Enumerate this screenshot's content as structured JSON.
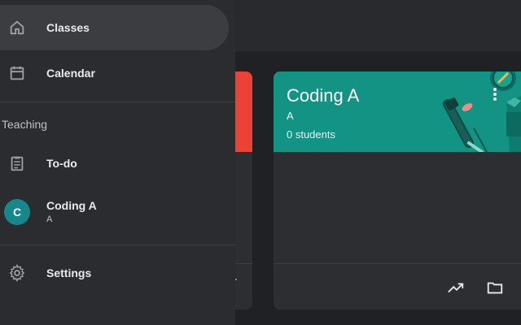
{
  "drawer": {
    "items": {
      "classes": {
        "label": "Classes",
        "icon": "home-icon",
        "active": true
      },
      "calendar": {
        "label": "Calendar",
        "icon": "calendar-icon"
      },
      "todo": {
        "label": "To-do",
        "icon": "clipboard-icon"
      },
      "class_coding_a": {
        "label": "Coding A",
        "sub": "A",
        "avatar_letter": "C",
        "avatar_color": "#16878a"
      },
      "settings": {
        "label": "Settings",
        "icon": "gear-icon"
      }
    },
    "section_teaching": "Teaching"
  },
  "class_card": {
    "title": "Coding A",
    "section": "A",
    "students": "0 students",
    "banner_color": "#129383",
    "actions": [
      "more-options-icon",
      "trending-icon",
      "folder-icon"
    ]
  },
  "other_card": {
    "banner_color": "#ea4335"
  },
  "colors": {
    "drawer_bg": "#2b2c2f",
    "page_bg": "#202124",
    "active_item": "#3c3d40"
  }
}
